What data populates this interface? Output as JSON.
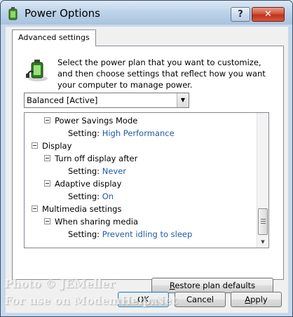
{
  "window": {
    "title": "Power Options",
    "help_label": "?",
    "close_label": "✕"
  },
  "tab": {
    "label": "Advanced settings"
  },
  "description": "Select the power plan that you want to customize, and then choose settings that reflect how you want your computer to manage power.",
  "plan_select": {
    "value": "Balanced [Active]"
  },
  "tree": {
    "rows": [
      {
        "label": "Power Savings Mode"
      },
      {
        "prefix": "Setting:",
        "value": "High Performance"
      },
      {
        "label": "Display"
      },
      {
        "label": "Turn off display after"
      },
      {
        "prefix": "Setting:",
        "value": "Never"
      },
      {
        "label": "Adaptive display"
      },
      {
        "prefix": "Setting:",
        "value": "On"
      },
      {
        "label": "Multimedia settings"
      },
      {
        "label": "When sharing media"
      },
      {
        "prefix": "Setting:",
        "value": "Prevent idling to sleep"
      }
    ]
  },
  "buttons": {
    "restore_first": "R",
    "restore_rest": "estore plan defaults",
    "ok": "OK",
    "cancel": "Cancel",
    "apply_first": "A",
    "apply_rest": "pply"
  },
  "watermark": {
    "line1": "Photo © JEMeller",
    "line2": "For use on ModemHelp.Net"
  },
  "colors": {
    "setting_value": "#1f5aa8",
    "close_button": "#c0321b"
  }
}
